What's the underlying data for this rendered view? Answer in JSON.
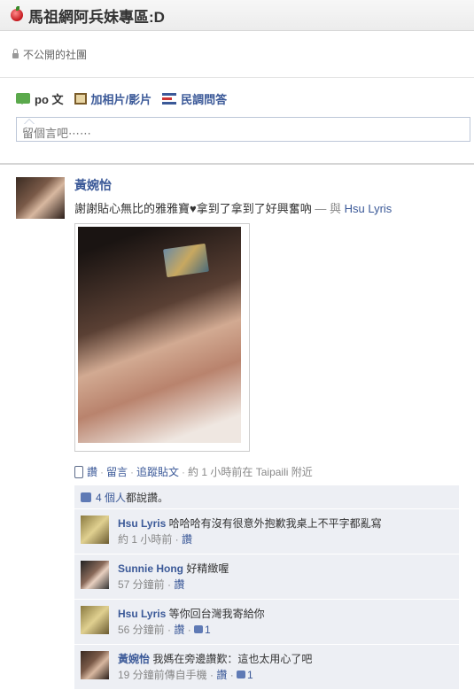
{
  "group": {
    "title": "馬祖網阿兵妹專區:D",
    "privacy": "不公開的社團"
  },
  "composer": {
    "tab_post": "po 文",
    "tab_photo": "加相片/影片",
    "tab_poll": "民調問答",
    "placeholder": "留個言吧⋯⋯"
  },
  "post": {
    "author": "黃婉怡",
    "text": "謝謝貼心無比的雅雅寶♥拿到了拿到了好興奮吶",
    "tag_sep": "— 與",
    "tag_user": "Hsu Lyris",
    "actions": {
      "like": "讚",
      "comment": "留言",
      "follow": "追蹤貼文",
      "time": "約 1 小時前在 Taipaili 附近"
    },
    "likes_link": "4 個人",
    "likes_text": "都說讚。",
    "comments": [
      {
        "name": "Hsu Lyris",
        "text": "哈哈哈有沒有很意外抱歉我桌上不平字都亂寫",
        "time": "約 1 小時前",
        "like": "讚",
        "like_count": ""
      },
      {
        "name": "Sunnie Hong",
        "text": "好精緻喔",
        "time": "57 分鐘前",
        "like": "讚",
        "like_count": ""
      },
      {
        "name": "Hsu Lyris",
        "text": "等你回台灣我寄給你",
        "time": "56 分鐘前",
        "like": "讚",
        "like_count": "1"
      },
      {
        "name": "黃婉怡",
        "text": "我媽在旁邊讚歎：這也太用心了吧",
        "time": "19 分鐘前傳自手機",
        "like": "讚",
        "like_count": "1"
      }
    ]
  }
}
